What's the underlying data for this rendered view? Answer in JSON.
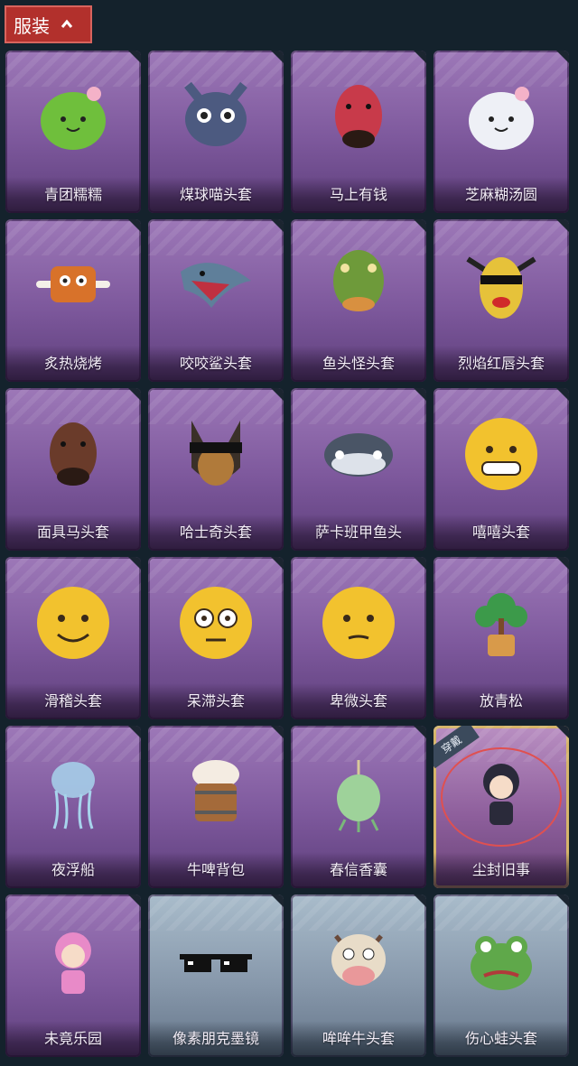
{
  "header": {
    "title": "服装"
  },
  "items": [
    {
      "name": "青团糯糯",
      "art": "green-dumpling-icon",
      "color": "#6fbf3c",
      "theme": "purple"
    },
    {
      "name": "煤球喵头套",
      "art": "cat-head-icon",
      "color": "#4c5a80",
      "theme": "purple"
    },
    {
      "name": "马上有钱",
      "art": "horse-head-icon",
      "color": "#c83a4a",
      "theme": "purple"
    },
    {
      "name": "芝麻糊汤圆",
      "art": "rice-ball-icon",
      "color": "#eef0f6",
      "theme": "purple"
    },
    {
      "name": "炙热烧烤",
      "art": "grilled-meat-icon",
      "color": "#d8722a",
      "theme": "purple"
    },
    {
      "name": "咬咬鲨头套",
      "art": "shark-head-icon",
      "color": "#5f7f9a",
      "theme": "purple"
    },
    {
      "name": "鱼头怪头套",
      "art": "fish-head-icon",
      "color": "#6e9a3a",
      "theme": "purple"
    },
    {
      "name": "烈焰红唇头套",
      "art": "yellow-mask-icon",
      "color": "#e6c23a",
      "theme": "purple"
    },
    {
      "name": "面具马头套",
      "art": "horse-mask-icon",
      "color": "#6a3b2a",
      "theme": "purple"
    },
    {
      "name": "哈士奇头套",
      "art": "husky-head-icon",
      "color": "#b07a3a",
      "theme": "purple"
    },
    {
      "name": "萨卡班甲鱼头",
      "art": "fish-face-icon",
      "color": "#4a5566",
      "theme": "purple"
    },
    {
      "name": "嘻嘻头套",
      "art": "grin-face-icon",
      "color": "#f2c22e",
      "theme": "purple"
    },
    {
      "name": "滑稽头套",
      "art": "smirk-face-icon",
      "color": "#f2c22e",
      "theme": "purple"
    },
    {
      "name": "呆滞头套",
      "art": "stare-face-icon",
      "color": "#f2c22e",
      "theme": "purple"
    },
    {
      "name": "卑微头套",
      "art": "humble-face-icon",
      "color": "#f2c22e",
      "theme": "purple"
    },
    {
      "name": "放青松",
      "art": "pine-tree-icon",
      "color": "#3c9a4a",
      "theme": "purple"
    },
    {
      "name": "夜浮船",
      "art": "jellyfish-icon",
      "color": "#a7d4ec",
      "theme": "purple"
    },
    {
      "name": "牛啤背包",
      "art": "beer-barrel-icon",
      "color": "#a46a3a",
      "theme": "purple"
    },
    {
      "name": "春信香囊",
      "art": "sachet-icon",
      "color": "#9ed29a",
      "theme": "purple"
    },
    {
      "name": "尘封旧事",
      "art": "doll-charm-icon",
      "color": "#2a2a3a",
      "theme": "equipped",
      "badge": "穿戴"
    },
    {
      "name": "未竟乐园",
      "art": "fairy-doll-icon",
      "color": "#e88ac8",
      "theme": "purple"
    },
    {
      "name": "像素朋克墨镜",
      "art": "pixel-sunglasses-icon",
      "color": "#111111",
      "theme": "blue"
    },
    {
      "name": "哞哞牛头套",
      "art": "cow-head-icon",
      "color": "#e8dcc8",
      "theme": "blue"
    },
    {
      "name": "伤心蛙头套",
      "art": "frog-head-icon",
      "color": "#5fa84a",
      "theme": "blue"
    }
  ]
}
